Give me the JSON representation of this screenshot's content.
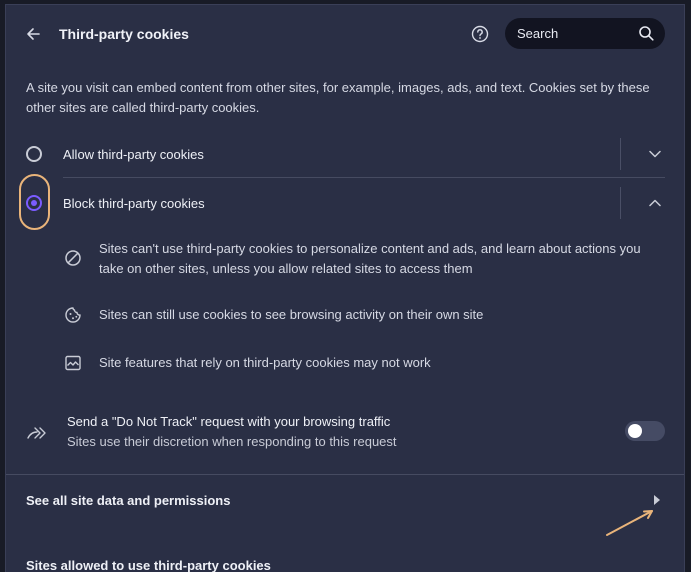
{
  "header": {
    "title": "Third-party cookies",
    "search_placeholder": "Search"
  },
  "intro": "A site you visit can embed content from other sites, for example, images, ads, and text. Cookies set by these other sites are called third-party cookies.",
  "options": [
    {
      "label": "Allow third-party cookies",
      "selected": false,
      "expanded": false
    },
    {
      "label": "Block third-party cookies",
      "selected": true,
      "expanded": true
    }
  ],
  "block_details": [
    {
      "icon": "block-icon",
      "text": "Sites can't use third-party cookies to personalize content and ads, and learn about actions you take on other sites, unless you allow related sites to access them"
    },
    {
      "icon": "cookie-icon",
      "text": "Sites can still use cookies to see browsing activity on their own site"
    },
    {
      "icon": "broken-image-icon",
      "text": "Site features that rely on third-party cookies may not work"
    }
  ],
  "do_not_track": {
    "title": "Send a \"Do Not Track\" request with your browsing traffic",
    "subtitle": "Sites use their discretion when responding to this request",
    "enabled": false
  },
  "links": {
    "site_data": "See all site data and permissions"
  },
  "sections": {
    "allowed_heading": "Sites allowed to use third-party cookies"
  },
  "colors": {
    "panel": "#2a2f45",
    "accent": "#7b5cff",
    "annotation": "#e9b47a"
  }
}
